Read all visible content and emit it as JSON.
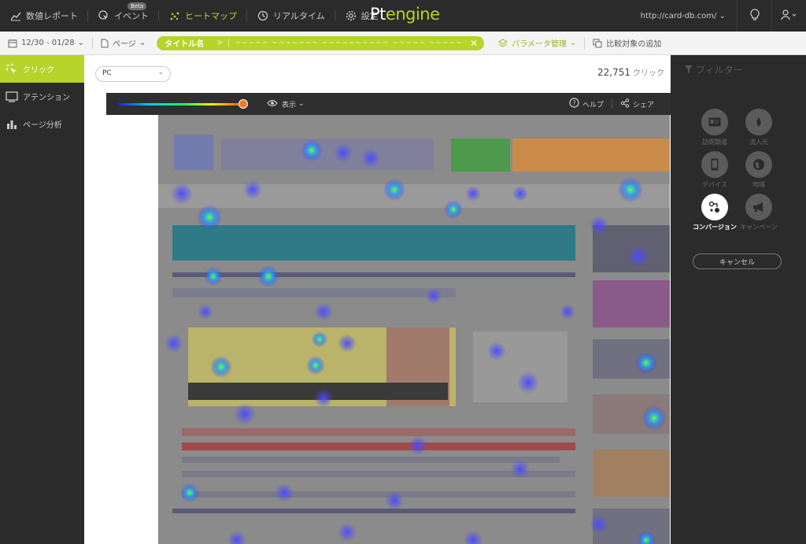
{
  "topnav": {
    "items": [
      {
        "label": "数値レポート",
        "icon": "line-chart-icon"
      },
      {
        "label": "イベント",
        "icon": "cursor-click-icon",
        "badge": "Beta"
      },
      {
        "label": "ヒートマップ",
        "icon": "heatmap-dots-icon",
        "active": true
      },
      {
        "label": "リアルタイム",
        "icon": "clock-icon"
      },
      {
        "label": "設定",
        "icon": "gear-icon"
      }
    ],
    "logo_pt": "Pt",
    "logo_engine": "engine",
    "url": "http://card-db.com/",
    "url_caret": "⌄"
  },
  "filterbar": {
    "date_range": "12/30 - 01/28",
    "page_label": "ページ",
    "title_label": "タイトル名",
    "title_chevron": ">",
    "title_value": "~~~~~ ~~~~~~~ ~~~~~~~~~~ ~~~~~ ~~~~~~~~",
    "title_clear": "✕",
    "param_label": "パラメータ管理",
    "compare_label": "比較対象の追加"
  },
  "sidebar": {
    "items": [
      {
        "label": "クリック",
        "active": true
      },
      {
        "label": "アテンション"
      },
      {
        "label": "ページ分析"
      }
    ]
  },
  "main": {
    "device": "PC",
    "click_count": "22,751",
    "click_unit": "クリック",
    "toolbar": {
      "view_label": "表示",
      "help_label": "ヘルプ",
      "share_label": "シェア"
    }
  },
  "rightpanel": {
    "filter_title": "フィルター",
    "filters": [
      {
        "label": "訪問類道",
        "icon": "id-card-icon"
      },
      {
        "label": "流入元",
        "icon": "droplet-icon"
      },
      {
        "label": "デバイス",
        "icon": "mobile-icon"
      },
      {
        "label": "地域",
        "icon": "globe-icon"
      },
      {
        "label": "コンバージョン",
        "icon": "conversion-icon",
        "active": true
      },
      {
        "label": "キャンペーン",
        "icon": "megaphone-icon"
      }
    ],
    "cancel_label": "キャンセル"
  },
  "colors": {
    "accent": "#b6d42b",
    "dark": "#2b2b2b",
    "knob": "#f07a2b"
  }
}
